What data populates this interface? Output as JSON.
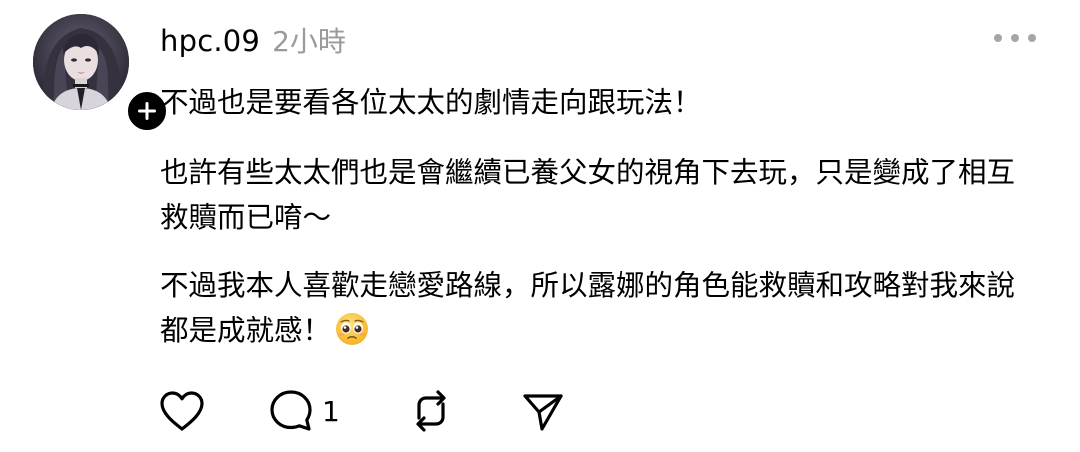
{
  "post": {
    "author": {
      "username": "hpc.09",
      "avatar_icon": "profile-photo",
      "follow_icon": "plus-icon"
    },
    "timestamp": "2小時",
    "more_icon": "more-horizontal-icon",
    "paragraphs": [
      "不過也是要看各位太太的劇情走向跟玩法！",
      "也許有些太太們也是會繼續已養父女的視角下去玩，只是變成了相互救贖而已唷～",
      "不過我本人喜歡走戀愛路線，所以露娜的角色能救贖和攻略對我來說都是成就感！"
    ],
    "paragraph3_emoji": "pleading-face-emoji",
    "actions": {
      "like_icon": "heart-icon",
      "reply_icon": "comment-bubble-icon",
      "reply_count": "1",
      "repost_icon": "repost-icon",
      "share_icon": "send-icon"
    }
  },
  "colors": {
    "text": "#000000",
    "muted": "#9a9a9a",
    "icon_gray": "#a6a6a6",
    "background": "#ffffff"
  }
}
